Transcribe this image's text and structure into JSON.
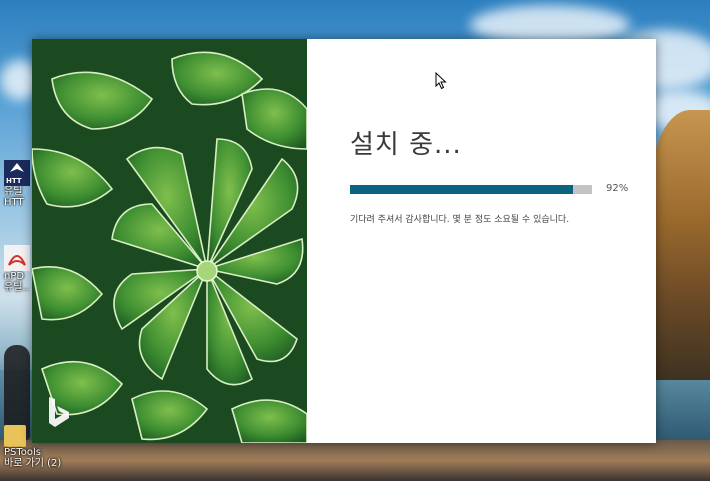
{
  "installer": {
    "title": "설치 중...",
    "progress": {
      "percent": 92,
      "label": "92%"
    },
    "message": "기다려 주셔서 감사합니다. 몇 분 정도 소요될 수 있습니다.",
    "brand_icon": "bing-logo-icon",
    "accent_color": "#0d6282",
    "track_color": "#c4c4c4"
  },
  "desktop": {
    "icons": [
      {
        "name": "httrack-app",
        "label": "유틸",
        "label2": "HTT",
        "icon": "httrack-icon"
      },
      {
        "name": "pdf-utility",
        "label": "nPD",
        "label2": "유틸..",
        "icon": "pdf-icon"
      },
      {
        "name": "pstools-folder",
        "label": "PSTools",
        "label2": "바로 가기 (2)",
        "icon": "folder-icon"
      }
    ]
  }
}
